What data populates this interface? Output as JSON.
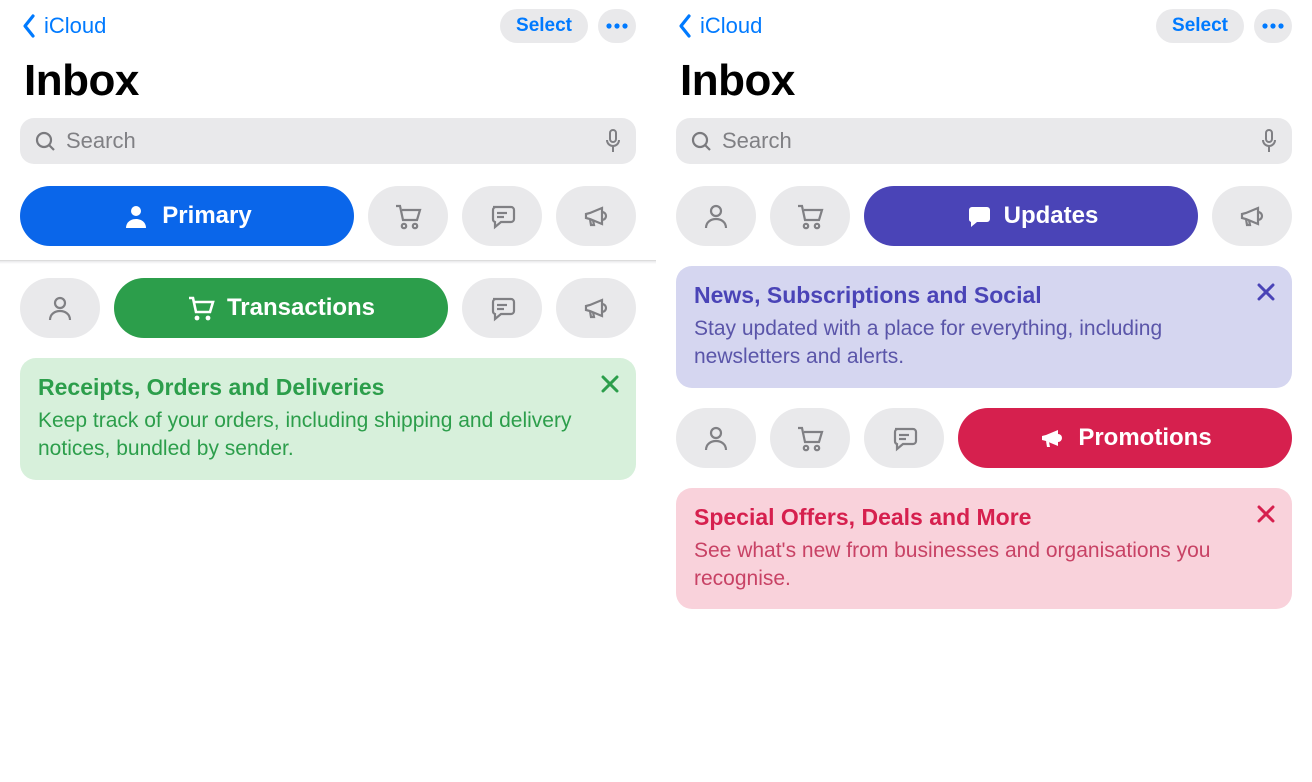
{
  "nav": {
    "back_label": "iCloud",
    "select_label": "Select"
  },
  "title": "Inbox",
  "search": {
    "placeholder": "Search"
  },
  "categories": {
    "primary_label": "Primary",
    "transactions_label": "Transactions",
    "updates_label": "Updates",
    "promotions_label": "Promotions"
  },
  "banners": {
    "transactions": {
      "title": "Receipts, Orders and Deliveries",
      "body": "Keep track of your orders, including shipping and delivery notices, bundled by sender."
    },
    "updates": {
      "title": "News, Subscriptions and Social",
      "body": "Stay updated with a place for everything, including newsletters and alerts."
    },
    "promotions": {
      "title": "Special Offers, Deals and More",
      "body": "See what's new from businesses and organisations you recognise."
    }
  },
  "colors": {
    "blue": "#0A66EA",
    "green": "#2C9E4B",
    "purple": "#4A44B7",
    "red": "#D6204E"
  }
}
